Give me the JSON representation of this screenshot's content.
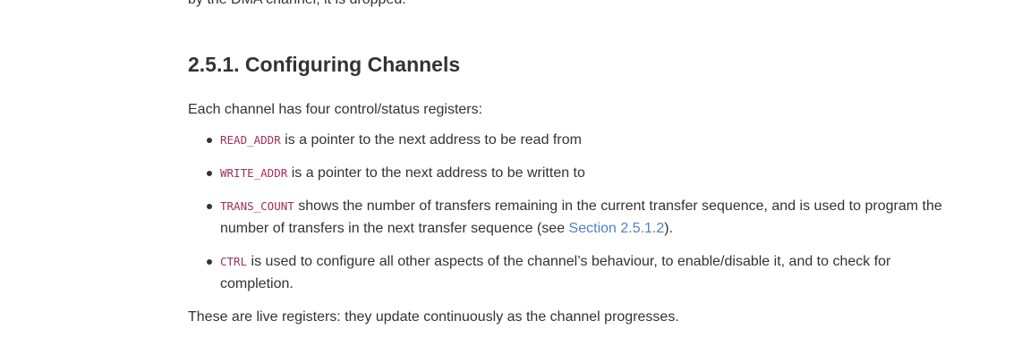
{
  "cut_line": "by the DMA channel, it is dropped.",
  "section": {
    "title": "2.5.1. Configuring Channels",
    "intro": "Each channel has four control/status registers:"
  },
  "registers": [
    {
      "name": "READ_ADDR",
      "text": " is a pointer to the next address to be read from"
    },
    {
      "name": "WRITE_ADDR",
      "text": " is a pointer to the next address to be written to"
    },
    {
      "name": "TRANS_COUNT",
      "text_before": " shows the number of transfers remaining in the current transfer sequence, and is used to program the number of transfers in the next transfer sequence (see ",
      "link": "Section 2.5.1.2",
      "text_after": ")."
    },
    {
      "name": "CTRL",
      "text": " is used to configure all other aspects of the channel’s behaviour, to enable/disable it, and to check for completion."
    }
  ],
  "closing": "These are live registers: they update continuously as the channel progresses.",
  "colors": {
    "text": "#333333",
    "code": "#a0305a",
    "link": "#4e82c4"
  }
}
